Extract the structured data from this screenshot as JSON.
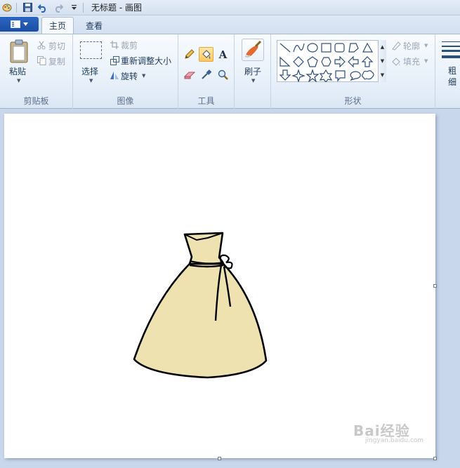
{
  "titlebar": {
    "title": "无标题 - 画图",
    "icons": [
      "paint-app-icon",
      "save-icon",
      "undo-icon",
      "redo-icon",
      "customize-quick-access-icon"
    ]
  },
  "tabs": [
    {
      "label": "主页",
      "active": true
    },
    {
      "label": "查看",
      "active": false
    }
  ],
  "clipboard": {
    "paste_label": "粘贴",
    "cut_label": "剪切",
    "copy_label": "复制",
    "group_label": "剪贴板"
  },
  "image": {
    "select_label": "选择",
    "crop_label": "裁剪",
    "resize_label": "重新调整大小",
    "rotate_label": "旋转",
    "group_label": "图像"
  },
  "tools": {
    "group_label": "工具",
    "items": [
      "pencil-icon",
      "fill-icon",
      "text-icon",
      "eraser-icon",
      "color-picker-icon",
      "magnifier-icon"
    ],
    "selected": "fill-icon",
    "text_glyph": "A"
  },
  "brushes": {
    "label": "刷子"
  },
  "shapes": {
    "group_label": "形状",
    "outline_label": "轮廓",
    "fill_label": "填充"
  },
  "size": {
    "label": "粗细"
  },
  "canvas": {
    "background": "#ffffff",
    "drawing": {
      "bag_fill": "#efe2b1",
      "stroke": "#000000"
    }
  },
  "watermark": {
    "text": "Bai经验",
    "sub": "jingyan.baidu.com"
  }
}
